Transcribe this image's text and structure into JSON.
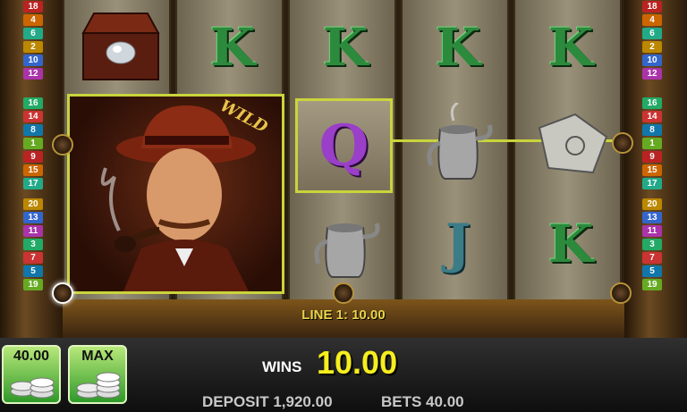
{
  "paytable_left": {
    "top": [
      "18",
      "4",
      "6",
      "2",
      "10",
      "12"
    ],
    "middle": [
      "16",
      "14",
      "8",
      "1",
      "9",
      "15",
      "17"
    ],
    "bottom": [
      "20",
      "13",
      "11",
      "3",
      "7",
      "5",
      "19"
    ]
  },
  "paytable_right": {
    "top": [
      "18",
      "4",
      "6",
      "2",
      "10",
      "12"
    ],
    "middle": [
      "16",
      "14",
      "8",
      "1",
      "9",
      "15",
      "17"
    ],
    "bottom": [
      "20",
      "13",
      "11",
      "3",
      "7",
      "5",
      "19"
    ]
  },
  "reels": {
    "wild_label": "WILD",
    "letters": {
      "k": "K",
      "j": "J",
      "q": "Q"
    }
  },
  "line_win": "LINE 1: 10.00",
  "buttons": {
    "bet_value": "40.00",
    "max_label": "MAX"
  },
  "wins": {
    "label": "WINS",
    "value": "10.00"
  },
  "footer": {
    "deposit": "DEPOSIT 1,920.00",
    "bets": "BETS 40.00"
  },
  "colors": {
    "win_frame": "#c9d43c",
    "wins_value": "#f6ee1e",
    "button_green": "#2f9a2a"
  }
}
